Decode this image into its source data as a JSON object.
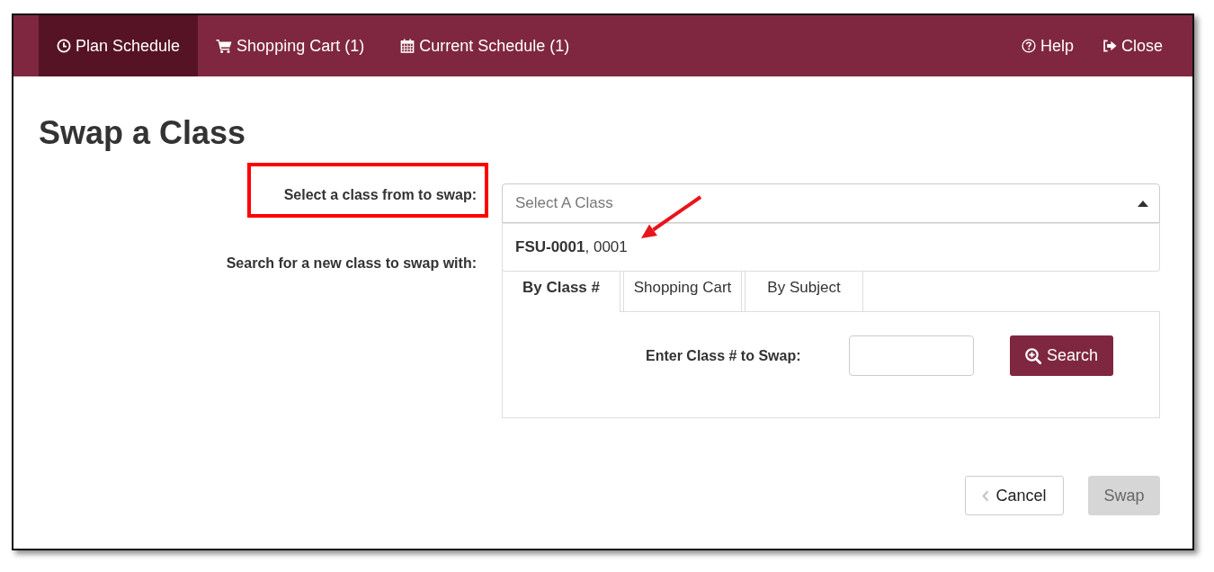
{
  "nav": {
    "tabs": [
      {
        "label": "Plan Schedule",
        "selected": true
      },
      {
        "label": "Shopping Cart (1)",
        "selected": false
      },
      {
        "label": "Current Schedule (1)",
        "selected": false
      }
    ],
    "actions": [
      {
        "label": "Help"
      },
      {
        "label": "Close"
      }
    ]
  },
  "title": "Swap a Class",
  "swap_from": {
    "label": "Select a class from to swap:",
    "highlighted": true,
    "select": {
      "placeholder": "Select A Class",
      "expanded": true,
      "options": [
        {
          "text": "**FSU-0001**, 0001",
          "pointed_at": true
        }
      ]
    }
  },
  "swap_with": {
    "label": "Search for a new class to swap with:",
    "tabs": [
      {
        "label": "By Class #",
        "selected": true
      },
      {
        "label": "Shopping Cart",
        "selected": false
      },
      {
        "label": "By Subject",
        "selected": false
      }
    ],
    "panel": {
      "label": "Enter Class # to Swap:",
      "button": "Search"
    }
  },
  "footer": {
    "buttons": [
      {
        "kind": "back",
        "label": "Cancel",
        "disabled": false
      },
      {
        "kind": "submit",
        "label": "Swap",
        "disabled": true
      }
    ]
  }
}
